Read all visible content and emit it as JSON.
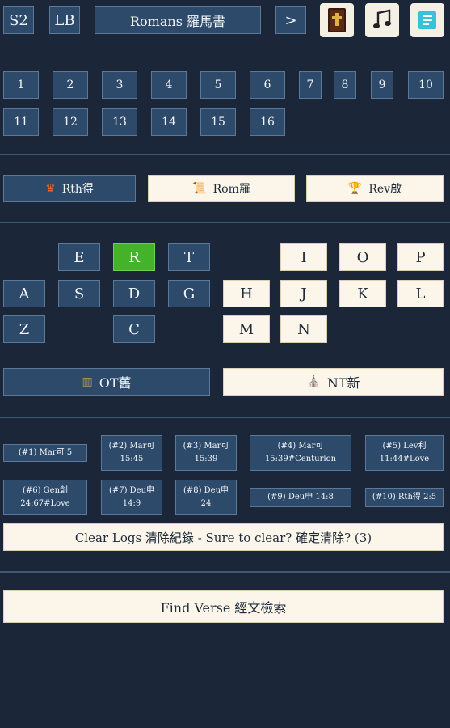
{
  "top_bar": {
    "s2": "S2",
    "lb": "LB",
    "book_title": "Romans 羅馬書",
    "next": ">"
  },
  "chapters": [
    "1",
    "2",
    "3",
    "4",
    "5",
    "6",
    "7",
    "8",
    "9",
    "10",
    "11",
    "12",
    "13",
    "14",
    "15",
    "16"
  ],
  "shortcuts": {
    "rth": "Rth得",
    "rom": "Rom羅",
    "rev": "Rev啟"
  },
  "keyboard": {
    "E": "E",
    "R": "R",
    "T": "T",
    "I": "I",
    "O": "O",
    "P": "P",
    "A": "A",
    "S": "S",
    "D": "D",
    "G": "G",
    "H": "H",
    "J": "J",
    "K": "K",
    "L": "L",
    "Z": "Z",
    "C": "C",
    "M": "M",
    "N": "N"
  },
  "testament": {
    "ot": "OT舊",
    "nt": "NT新"
  },
  "logs": [
    {
      "l1": "(#1) Mar可 5",
      "l2": ""
    },
    {
      "l1": "(#2) Mar可",
      "l2": "15:45"
    },
    {
      "l1": "(#3) Mar可",
      "l2": "15:39"
    },
    {
      "l1": "(#4) Mar可",
      "l2": "15:39#Centurion"
    },
    {
      "l1": "(#5) Lev利",
      "l2": "11:44#Love"
    },
    {
      "l1": "(#6) Gen創",
      "l2": "24:67#Love"
    },
    {
      "l1": "(#7) Deu申",
      "l2": "14:9"
    },
    {
      "l1": "(#8) Deu申",
      "l2": "24"
    },
    {
      "l1": "(#9) Deu申 14:8",
      "l2": ""
    },
    {
      "l1": "(#10) Rth得 2:5",
      "l2": ""
    }
  ],
  "clear_logs": "Clear Logs 清除紀錄 - Sure to clear? 確定清除? (3)",
  "find_verse": "Find Verse 經文檢索",
  "colors": {
    "background": "#1b2738",
    "button": "#2e4a6b",
    "light_button": "#fbf6e9",
    "active_key": "#44b32a"
  },
  "icons": [
    "bible-book-icon",
    "music-note-icon",
    "sticky-note-icon",
    "crown-icon",
    "scroll-icon",
    "trophy-icon",
    "book-icon",
    "church-icon"
  ]
}
